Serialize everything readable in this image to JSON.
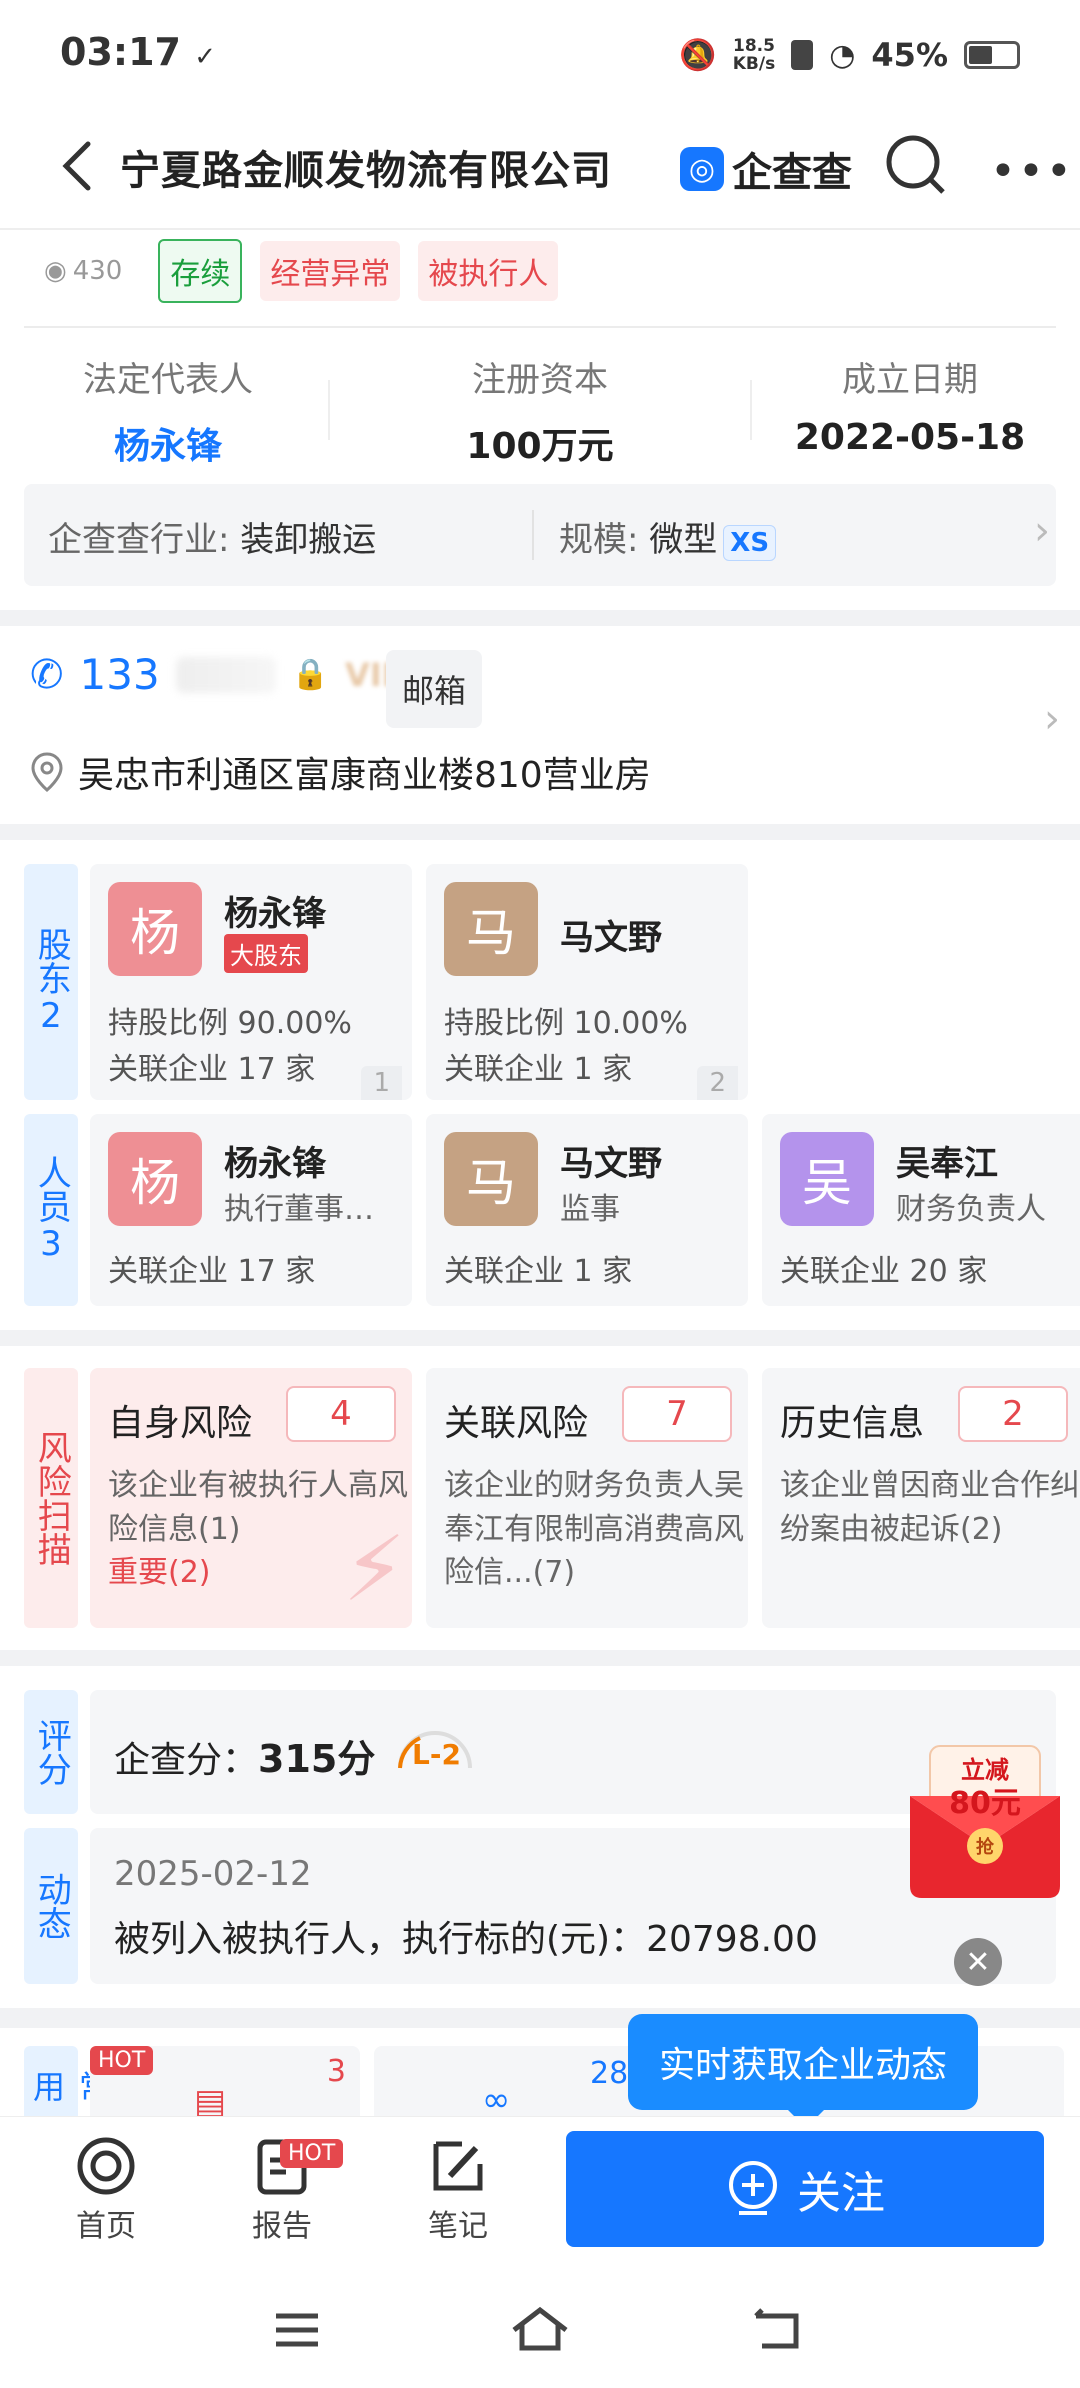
{
  "status": {
    "time": "03:17",
    "net_speed_top": "18.5",
    "net_speed_unit": "KB/s",
    "battery": "45%"
  },
  "header": {
    "title": "宁夏路金顺发物流有限公司",
    "brand": "企查查"
  },
  "company": {
    "views": "430",
    "tags": [
      "存续",
      "经营异常",
      "被执行人"
    ],
    "info": [
      {
        "label": "法定代表人",
        "value": "杨永锋"
      },
      {
        "label": "注册资本",
        "value": "100万元"
      },
      {
        "label": "成立日期",
        "value": "2022-05-18"
      }
    ],
    "industry_key": "企查查行业:",
    "industry_val": "装卸搬运",
    "scale_key": "规模:",
    "scale_val": "微型",
    "scale_badge": "XS"
  },
  "contact": {
    "phone_prefix": "133",
    "vip": "VIP",
    "email_btn": "邮箱",
    "address": "吴忠市利通区富康商业楼810营业房"
  },
  "shareholders": {
    "label": "股东",
    "count": "2",
    "items": [
      {
        "avatar": "杨",
        "name": "杨永锋",
        "badge": "大股东",
        "ratio": "持股比例 90.00%",
        "related": "关联企业 17 家",
        "idx": "1"
      },
      {
        "avatar": "马",
        "name": "马文野",
        "ratio": "持股比例 10.00%",
        "related": "关联企业 1 家",
        "idx": "2"
      }
    ]
  },
  "staff": {
    "label": "人员",
    "count": "3",
    "items": [
      {
        "avatar": "杨",
        "name": "杨永锋",
        "role": "执行董事…",
        "related": "关联企业 17 家"
      },
      {
        "avatar": "马",
        "name": "马文野",
        "role": "监事",
        "related": "关联企业 1 家"
      },
      {
        "avatar": "吴",
        "name": "吴奉江",
        "role": "财务负责人",
        "related": "关联企业 20 家"
      }
    ]
  },
  "risk": {
    "label": "风险扫描",
    "items": [
      {
        "title": "自身风险",
        "count": "4",
        "desc": "该企业有被执行人高风险信息(1)",
        "important": "重要(2)"
      },
      {
        "title": "关联风险",
        "count": "7",
        "desc": "该企业的财务负责人吴奉江有限制高消费高风险信...(7)"
      },
      {
        "title": "历史信息",
        "count": "2",
        "desc": "该企业曾因商业合作纠纷案由被起诉(2)"
      }
    ]
  },
  "score": {
    "label": "评分",
    "prefix": "企查分：",
    "value": "315分",
    "level": "L-2"
  },
  "dynamic": {
    "label": "动态",
    "date": "2025-02-12",
    "desc": "被列入被执行人，执行标的(元)：20798.00"
  },
  "promo": {
    "top": "立减",
    "amount": "80元",
    "btn": "抢"
  },
  "common": {
    "label": "常用",
    "hot": "HOT",
    "count1": "3",
    "count2": "28"
  },
  "tooltip": "实时获取企业动态",
  "tabs": [
    {
      "label": "首页"
    },
    {
      "label": "报告",
      "hot": "HOT"
    },
    {
      "label": "笔记"
    }
  ],
  "follow": "关注"
}
